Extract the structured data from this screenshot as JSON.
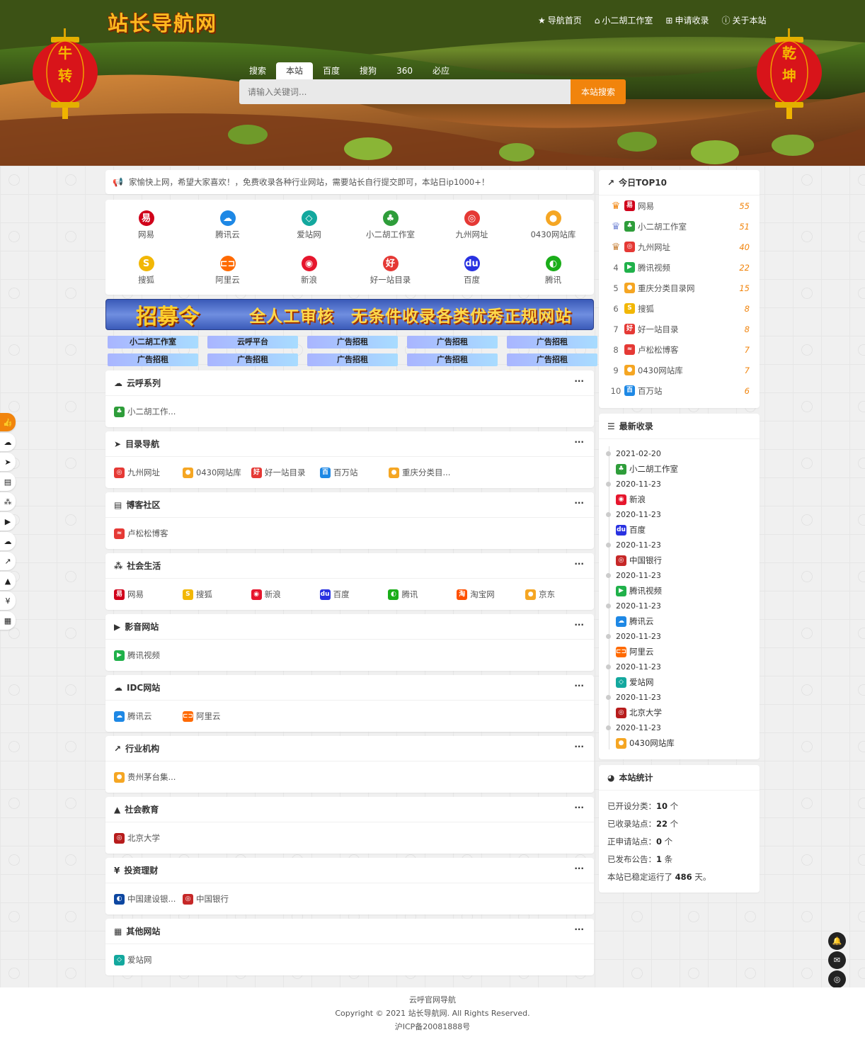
{
  "header": {
    "logo": "站长导航网",
    "nav": [
      {
        "icon": "star-icon",
        "glyph": "★",
        "label": "导航首页"
      },
      {
        "icon": "home-icon",
        "glyph": "⌂",
        "label": "小二胡工作室"
      },
      {
        "icon": "plus-square-icon",
        "glyph": "⊞",
        "label": "申请收录"
      },
      {
        "icon": "info-icon",
        "glyph": "ⓘ",
        "label": "关于本站"
      }
    ],
    "lantern_left": [
      "牛",
      "转"
    ],
    "lantern_right": [
      "乾",
      "坤"
    ]
  },
  "search": {
    "tabs": [
      "搜索",
      "本站",
      "百度",
      "搜狗",
      "360",
      "必应"
    ],
    "active": 1,
    "placeholder": "请输入关键词...",
    "button": "本站搜索"
  },
  "notice": "家愉快上网，希望大家喜欢！，免费收录各种行业网站，需要站长自行提交即可，本站日ip1000+！",
  "quick": [
    {
      "label": "网易",
      "glyph": "易",
      "color": "#d0021b"
    },
    {
      "label": "腾讯云",
      "glyph": "☁",
      "color": "#1e88e5"
    },
    {
      "label": "爱站网",
      "glyph": "◇",
      "color": "#13a89e"
    },
    {
      "label": "小二胡工作室",
      "glyph": "♣",
      "color": "#2e9d3a"
    },
    {
      "label": "九州网址",
      "glyph": "◎",
      "color": "#e53935"
    },
    {
      "label": "0430网站库",
      "glyph": "●",
      "color": "#f5a623"
    },
    {
      "label": "搜狐",
      "glyph": "S",
      "color": "#f2b705"
    },
    {
      "label": "阿里云",
      "glyph": "⊏⊐",
      "color": "#ff6a00"
    },
    {
      "label": "新浪",
      "glyph": "◉",
      "color": "#e6162d"
    },
    {
      "label": "好一站目录",
      "glyph": "好",
      "color": "#e53935"
    },
    {
      "label": "百度",
      "glyph": "du",
      "color": "#2932e1"
    },
    {
      "label": "腾讯",
      "glyph": "◐",
      "color": "#1aad19"
    }
  ],
  "banner": {
    "left": "招募令",
    "right": "全人工审核　无条件收录各类优秀正规网站"
  },
  "ads": [
    "小二胡工作室",
    "云呼平台",
    "广告招租",
    "广告招租",
    "广告招租",
    "广告招租",
    "广告招租",
    "广告招租",
    "广告招租",
    "广告招租"
  ],
  "sections": [
    {
      "title": "云呼系列",
      "glyph": "☁",
      "links": [
        {
          "t": "小二胡工作...",
          "g": "♣",
          "c": "#2e9d3a"
        }
      ]
    },
    {
      "title": "目录导航",
      "glyph": "➤",
      "links": [
        {
          "t": "九州网址",
          "g": "◎",
          "c": "#e53935"
        },
        {
          "t": "0430网站库",
          "g": "●",
          "c": "#f5a623"
        },
        {
          "t": "好一站目录",
          "g": "好",
          "c": "#e53935"
        },
        {
          "t": "百万站",
          "g": "百",
          "c": "#1e88e5"
        },
        {
          "t": "重庆分类目...",
          "g": "●",
          "c": "#f5a623"
        }
      ]
    },
    {
      "title": "博客社区",
      "glyph": "▤",
      "links": [
        {
          "t": "卢松松博客",
          "g": "≈",
          "c": "#e53935"
        }
      ]
    },
    {
      "title": "社会生活",
      "glyph": "⁂",
      "links": [
        {
          "t": "网易",
          "g": "易",
          "c": "#d0021b"
        },
        {
          "t": "搜狐",
          "g": "S",
          "c": "#f2b705"
        },
        {
          "t": "新浪",
          "g": "◉",
          "c": "#e6162d"
        },
        {
          "t": "百度",
          "g": "du",
          "c": "#2932e1"
        },
        {
          "t": "腾讯",
          "g": "◐",
          "c": "#1aad19"
        },
        {
          "t": "淘宝网",
          "g": "淘",
          "c": "#ff5000"
        },
        {
          "t": "京东",
          "g": "●",
          "c": "#f5a623"
        }
      ]
    },
    {
      "title": "影音网站",
      "glyph": "▶",
      "links": [
        {
          "t": "腾讯视频",
          "g": "▶",
          "c": "#20b14a"
        }
      ]
    },
    {
      "title": "IDC网站",
      "glyph": "☁",
      "links": [
        {
          "t": "腾讯云",
          "g": "☁",
          "c": "#1e88e5"
        },
        {
          "t": "阿里云",
          "g": "⊏⊐",
          "c": "#ff6a00"
        }
      ]
    },
    {
      "title": "行业机构",
      "glyph": "↗",
      "links": [
        {
          "t": "贵州茅台集...",
          "g": "●",
          "c": "#f5a623"
        }
      ]
    },
    {
      "title": "社会教育",
      "glyph": "▲",
      "links": [
        {
          "t": "北京大学",
          "g": "◎",
          "c": "#b71c1c"
        }
      ]
    },
    {
      "title": "投资理财",
      "glyph": "¥",
      "links": [
        {
          "t": "中国建设银...",
          "g": "◐",
          "c": "#0d47a1"
        },
        {
          "t": "中国银行",
          "g": "◎",
          "c": "#c62828"
        }
      ]
    },
    {
      "title": "其他网站",
      "glyph": "▦",
      "links": [
        {
          "t": "爱站网",
          "g": "◇",
          "c": "#13a89e"
        }
      ]
    }
  ],
  "more": "···",
  "top10": {
    "title": "今日TOP10",
    "rows": [
      {
        "r": "",
        "n": "网易",
        "g": "易",
        "c": "#d0021b",
        "v": "55"
      },
      {
        "r": "",
        "n": "小二胡工作室",
        "g": "♣",
        "c": "#2e9d3a",
        "v": "51"
      },
      {
        "r": "",
        "n": "九州网址",
        "g": "◎",
        "c": "#e53935",
        "v": "40"
      },
      {
        "r": "4",
        "n": "腾讯视频",
        "g": "▶",
        "c": "#20b14a",
        "v": "22"
      },
      {
        "r": "5",
        "n": "重庆分类目录网",
        "g": "●",
        "c": "#f5a623",
        "v": "15"
      },
      {
        "r": "6",
        "n": "搜狐",
        "g": "S",
        "c": "#f2b705",
        "v": "8"
      },
      {
        "r": "7",
        "n": "好一站目录",
        "g": "好",
        "c": "#e53935",
        "v": "8"
      },
      {
        "r": "8",
        "n": "卢松松博客",
        "g": "≈",
        "c": "#e53935",
        "v": "7"
      },
      {
        "r": "9",
        "n": "0430网站库",
        "g": "●",
        "c": "#f5a623",
        "v": "7"
      },
      {
        "r": "10",
        "n": "百万站",
        "g": "百",
        "c": "#1e88e5",
        "v": "6"
      }
    ]
  },
  "latest": {
    "title": "最新收录",
    "rows": [
      {
        "d": "2021-02-20",
        "n": "小二胡工作室",
        "g": "♣",
        "c": "#2e9d3a"
      },
      {
        "d": "2020-11-23",
        "n": "新浪",
        "g": "◉",
        "c": "#e6162d"
      },
      {
        "d": "2020-11-23",
        "n": "百度",
        "g": "du",
        "c": "#2932e1"
      },
      {
        "d": "2020-11-23",
        "n": "中国银行",
        "g": "◎",
        "c": "#c62828"
      },
      {
        "d": "2020-11-23",
        "n": "腾讯视频",
        "g": "▶",
        "c": "#20b14a"
      },
      {
        "d": "2020-11-23",
        "n": "腾讯云",
        "g": "☁",
        "c": "#1e88e5"
      },
      {
        "d": "2020-11-23",
        "n": "阿里云",
        "g": "⊏⊐",
        "c": "#ff6a00"
      },
      {
        "d": "2020-11-23",
        "n": "爱站网",
        "g": "◇",
        "c": "#13a89e"
      },
      {
        "d": "2020-11-23",
        "n": "北京大学",
        "g": "◎",
        "c": "#b71c1c"
      },
      {
        "d": "2020-11-23",
        "n": "0430网站库",
        "g": "●",
        "c": "#f5a623"
      }
    ]
  },
  "stats": {
    "title": "本站统计",
    "rows": [
      {
        "k": "已开设分类：",
        "v": "10",
        "u": " 个"
      },
      {
        "k": "已收录站点：",
        "v": "22",
        "u": " 个"
      },
      {
        "k": "正申请站点：",
        "v": "0",
        "u": " 个"
      },
      {
        "k": "已发布公告：",
        "v": "1",
        "u": " 条"
      },
      {
        "k": "本站已稳定运行了 ",
        "v": "486",
        "u": " 天。"
      }
    ]
  },
  "leftbar": [
    "👍",
    "☁",
    "➤",
    "▤",
    "⁂",
    "▶",
    "☁",
    "↗",
    "▲",
    "¥",
    "▦"
  ],
  "rightbar": [
    "🔔",
    "✉",
    "◎"
  ],
  "footer": {
    "l1": "云呼官网导航",
    "l2": "Copyright © 2021 站长导航网. All Rights Reserved.",
    "l3": "沪ICP备20081888号"
  }
}
